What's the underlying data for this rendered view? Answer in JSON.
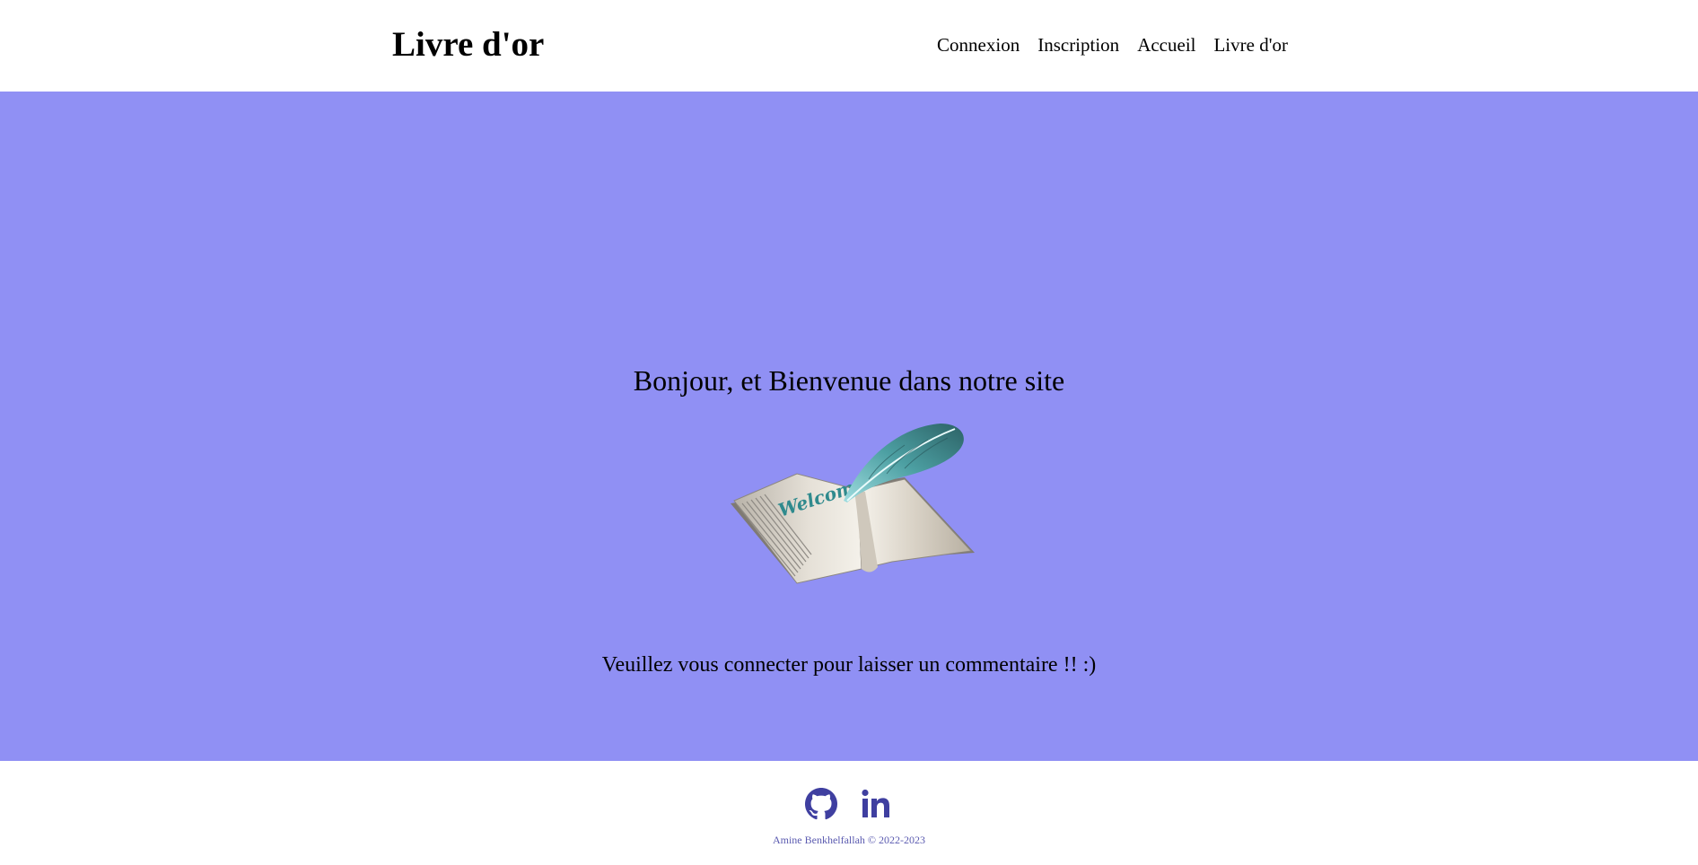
{
  "header": {
    "site_title": "Livre d'or",
    "nav": {
      "login": "Connexion",
      "register": "Inscription",
      "home": "Accueil",
      "guestbook": "Livre d'or"
    }
  },
  "main": {
    "title": "Bonjour, et Bienvenue dans notre site",
    "image_text": "Welcome",
    "message": "Veuillez vous connecter pour laisser un commentaire !! :)"
  },
  "footer": {
    "copyright": "Amine Benkhelfallah © 2022-2023"
  },
  "icons": {
    "github": "github-icon",
    "linkedin": "linkedin-icon"
  },
  "colors": {
    "main_background": "#9090f4",
    "footer_icon": "#3f3fa0",
    "copyright_text": "#5b5bb0",
    "header_background": "#ffffff"
  }
}
